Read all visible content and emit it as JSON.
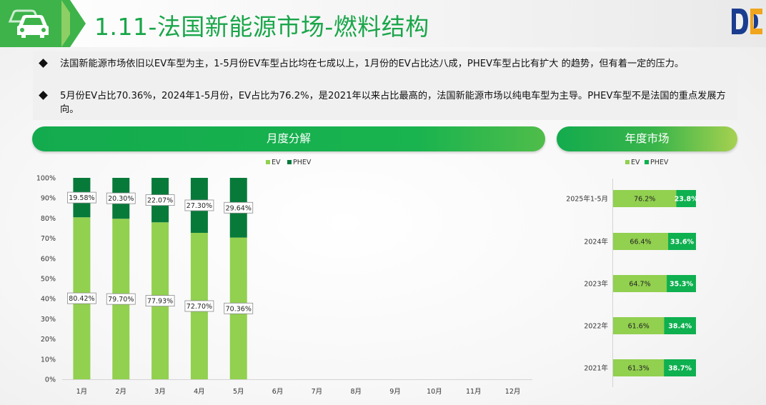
{
  "header": {
    "title": "1.11-法国新能源市场-燃料结构",
    "icon": "car-icon",
    "logo": "company-logo"
  },
  "bullets": [
    "法国新能源市场依旧以EV车型为主，1-5月份EV车型占比均在七成以上，1月份的EV占比达八成，PHEV车型占比有扩大 的趋势，但有着一定的压力。",
    "5月份EV占比70.36%，2024年1-5月份，EV占比为76.2%，是2021年以来占比最高的，法国新能源市场以纯电车型为主导。PHEV车型不是法国的重点发展方向。"
  ],
  "sections": {
    "monthly": "月度分解",
    "annual": "年度市场"
  },
  "colors": {
    "ev_monthly": "#92d050",
    "phev_monthly": "#077a3a",
    "ev_annual": "#92d050",
    "phev_annual": "#0eb04f",
    "title": "#1aa64a",
    "brand_green": "#3db34a"
  },
  "chart_data": [
    {
      "type": "bar",
      "stacked": true,
      "percent_stacked": true,
      "orientation": "vertical",
      "categories": [
        "1月",
        "2月",
        "3月",
        "4月",
        "5月",
        "6月",
        "7月",
        "8月",
        "9月",
        "10月",
        "11月",
        "12月"
      ],
      "series": [
        {
          "name": "EV",
          "values": [
            80.42,
            79.7,
            77.93,
            72.7,
            70.36,
            null,
            null,
            null,
            null,
            null,
            null,
            null
          ]
        },
        {
          "name": "PHEV",
          "values": [
            19.58,
            20.3,
            22.07,
            27.3,
            29.64,
            null,
            null,
            null,
            null,
            null,
            null,
            null
          ]
        }
      ],
      "data_labels": {
        "EV": [
          "80.42%",
          "79.70%",
          "77.93%",
          "72.70%",
          "70.36%"
        ],
        "PHEV": [
          "19.58%",
          "20.30%",
          "22.07%",
          "27.30%",
          "29.64%"
        ]
      },
      "yticks": [
        "0%",
        "10%",
        "20%",
        "30%",
        "40%",
        "50%",
        "60%",
        "70%",
        "80%",
        "90%",
        "100%"
      ],
      "ylim": [
        0,
        100
      ],
      "legend": "top",
      "grid": false
    },
    {
      "type": "bar",
      "stacked": true,
      "percent_stacked": true,
      "orientation": "horizontal",
      "categories": [
        "2025年1-5月",
        "2024年",
        "2023年",
        "2022年",
        "2021年"
      ],
      "series": [
        {
          "name": "EV",
          "values": [
            76.2,
            66.4,
            64.7,
            61.6,
            61.3
          ]
        },
        {
          "name": "PHEV",
          "values": [
            23.8,
            33.6,
            35.3,
            38.4,
            38.7
          ]
        }
      ],
      "data_labels": {
        "EV": [
          "76.2%",
          "66.4%",
          "64.7%",
          "61.6%",
          "61.3%"
        ],
        "PHEV": [
          "23.8%",
          "33.6%",
          "35.3%",
          "38.4%",
          "38.7%"
        ]
      },
      "xlim": [
        0,
        100
      ],
      "legend": "top",
      "grid": false
    }
  ]
}
